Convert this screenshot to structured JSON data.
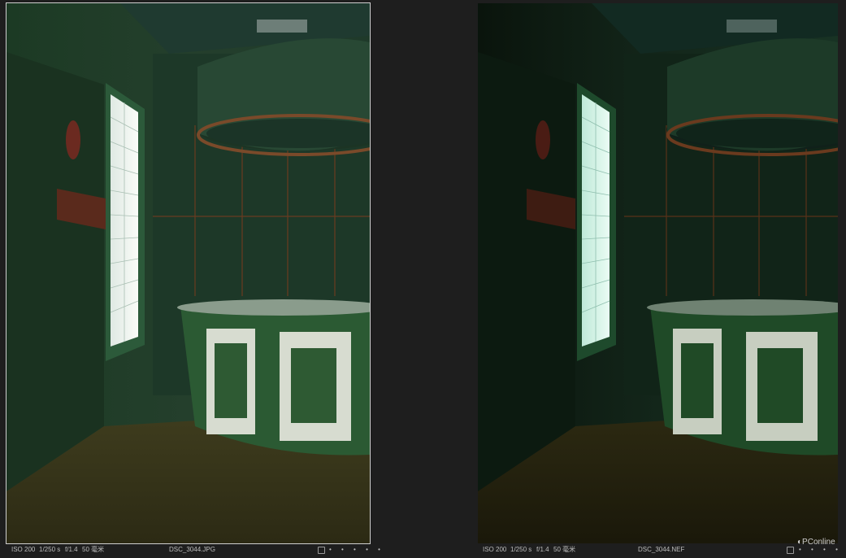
{
  "left_image": {
    "iso": "ISO 200",
    "shutter": "1/250 s",
    "aperture": "f/1.4",
    "focal_length": "50 毫米",
    "filename": "DSC_3044.JPG",
    "selected": true,
    "rating_dots": "• • • • •"
  },
  "right_image": {
    "iso": "ISO 200",
    "shutter": "1/250 s",
    "aperture": "f/1.4",
    "focal_length": "50 毫米",
    "filename": "DSC_3044.NEF",
    "selected": false,
    "rating_dots": "• • • • •"
  },
  "watermark": "PConline"
}
